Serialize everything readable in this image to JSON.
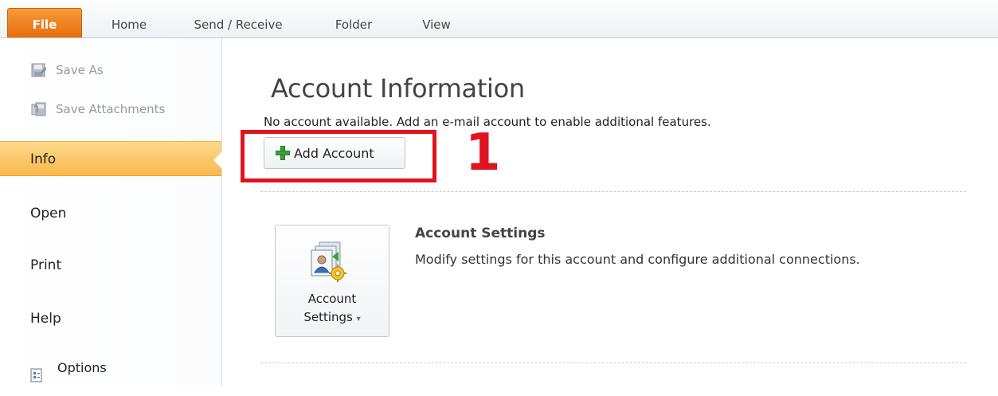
{
  "tabs": [
    {
      "label": "File"
    },
    {
      "label": "Home"
    },
    {
      "label": "Send / Receive"
    },
    {
      "label": "Folder"
    },
    {
      "label": "View"
    }
  ],
  "sidebar": {
    "commands": [
      {
        "label": "Save As",
        "icon": "save-as-icon"
      },
      {
        "label": "Save Attachments",
        "icon": "save-attachments-icon"
      }
    ],
    "items": [
      {
        "label": "Info"
      },
      {
        "label": "Open"
      },
      {
        "label": "Print"
      },
      {
        "label": "Help"
      },
      {
        "label": "Options",
        "icon": "options-icon"
      }
    ]
  },
  "main": {
    "title": "Account Information",
    "description": "No account available. Add an e-mail account to enable additional features.",
    "add_account_label": "Add Account",
    "annotation_number": "1",
    "account_settings": {
      "button_line1": "Account",
      "button_line2": "Settings",
      "dropdown_glyph": "▾",
      "heading": "Account Settings",
      "description": "Modify settings for this account and configure additional connections."
    }
  },
  "colors": {
    "file_tab": "#e86d0c",
    "active_nav": "#f9b94c",
    "annotation_red": "#e0141e",
    "plus_green": "#3aa33a"
  }
}
